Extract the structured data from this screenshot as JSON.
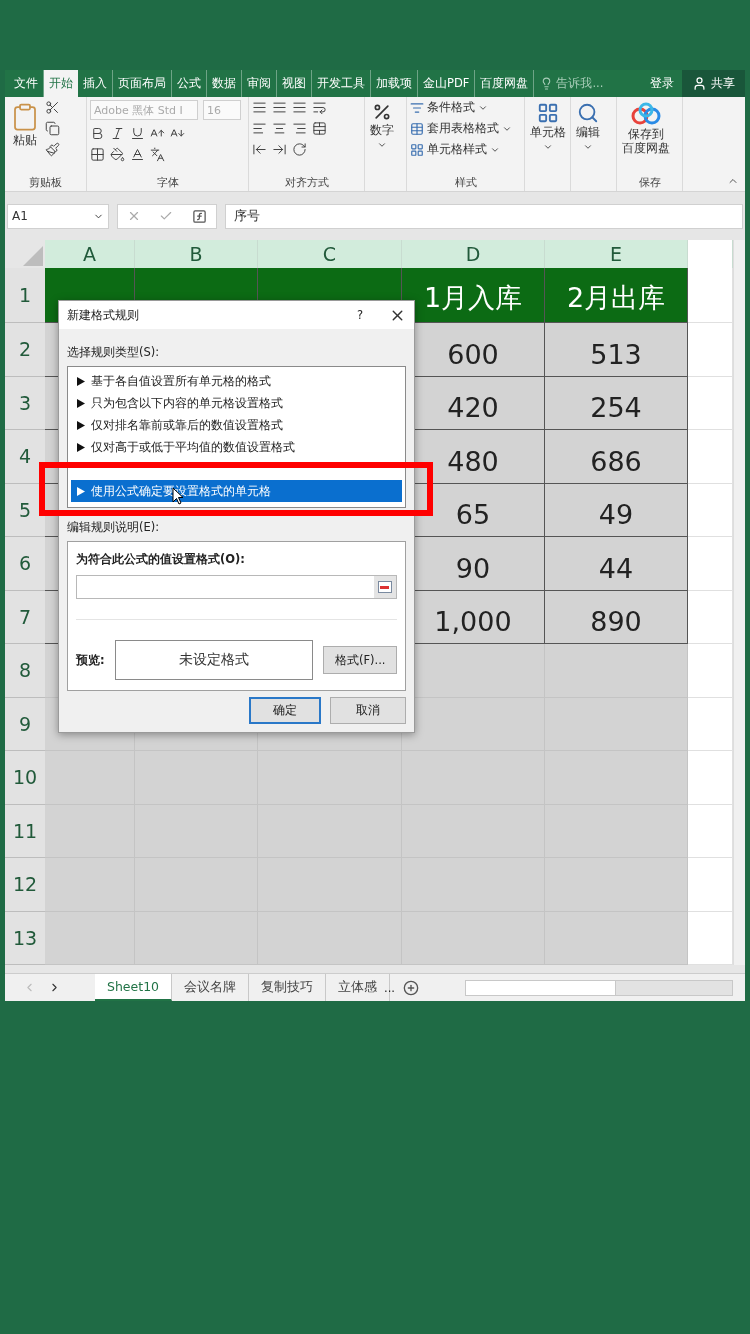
{
  "ribbon_tabs": [
    {
      "label": "文件",
      "selected": false
    },
    {
      "label": "开始",
      "selected": true
    },
    {
      "label": "插入",
      "selected": false
    },
    {
      "label": "页面布局",
      "selected": false
    },
    {
      "label": "公式",
      "selected": false
    },
    {
      "label": "数据",
      "selected": false
    },
    {
      "label": "审阅",
      "selected": false
    },
    {
      "label": "视图",
      "selected": false
    },
    {
      "label": "开发工具",
      "selected": false
    },
    {
      "label": "加载项",
      "selected": false
    },
    {
      "label": "金山PDF",
      "selected": false
    },
    {
      "label": "百度网盘",
      "selected": false
    }
  ],
  "tell_me": "告诉我...",
  "sign_in": "登录",
  "share": "共享",
  "ribbon": {
    "clipboard": {
      "paste": "粘贴",
      "label": "剪贴板"
    },
    "font": {
      "name": "Adobe 黑体 Std I",
      "size": "16",
      "label": "字体"
    },
    "alignment": {
      "label": "对齐方式"
    },
    "number": {
      "button": "数字"
    },
    "styles": {
      "items": [
        "条件格式",
        "套用表格格式",
        "单元格样式"
      ],
      "label": "样式"
    },
    "cells": {
      "button": "单元格"
    },
    "editing": {
      "button": "编辑"
    },
    "save": {
      "button": [
        "保存到",
        "百度网盘"
      ],
      "label": "保存"
    }
  },
  "formula_bar": {
    "name_box": "A1",
    "content": "序号"
  },
  "sheet": {
    "columns": [
      "A",
      "B",
      "C",
      "D",
      "E"
    ],
    "rows": [
      {
        "number": "1",
        "kind": "header",
        "cells": {
          "D": "1月入库",
          "E": "2月出库"
        }
      },
      {
        "number": "2",
        "kind": "data",
        "cells": {
          "D": "600",
          "E": "513"
        }
      },
      {
        "number": "3",
        "kind": "data",
        "cells": {
          "D": "420",
          "E": "254"
        }
      },
      {
        "number": "4",
        "kind": "data",
        "cells": {
          "D": "480",
          "E": "686"
        }
      },
      {
        "number": "5",
        "kind": "data",
        "cells": {
          "D": "65",
          "E": "49"
        }
      },
      {
        "number": "6",
        "kind": "data",
        "cells": {
          "D": "90",
          "E": "44"
        }
      },
      {
        "number": "7",
        "kind": "data",
        "cells": {
          "D": "1,000",
          "E": "890"
        }
      },
      {
        "number": "8",
        "kind": "blank"
      },
      {
        "number": "9",
        "kind": "blank"
      },
      {
        "number": "10",
        "kind": "blank"
      },
      {
        "number": "11",
        "kind": "blank"
      },
      {
        "number": "12",
        "kind": "blank"
      },
      {
        "number": "13",
        "kind": "blank"
      }
    ]
  },
  "sheet_tabs": [
    {
      "label": "Sheet10",
      "selected": true
    },
    {
      "label": "会议名牌",
      "selected": false
    },
    {
      "label": "复制技巧",
      "selected": false
    },
    {
      "label": "立体感",
      "selected": false
    }
  ],
  "more_tabs": "...",
  "dialog": {
    "title": "新建格式规则",
    "help": "?",
    "select_label": "选择规则类型(S):",
    "rule_types": [
      {
        "label": "基于各自值设置所有单元格的格式",
        "selected": false
      },
      {
        "label": "只为包含以下内容的单元格设置格式",
        "selected": false
      },
      {
        "label": "仅对排名靠前或靠后的数值设置格式",
        "selected": false
      },
      {
        "label": "仅对高于或低于平均值的数值设置格式",
        "selected": false
      },
      {
        "label": "使用公式确定要设置格式的单元格",
        "selected": true
      }
    ],
    "edit_label": "编辑规则说明(E):",
    "formula_label": "为符合此公式的值设置格式(O):",
    "preview_label": "预览:",
    "preview_text": "未设定格式",
    "format_button": "格式(F)...",
    "ok": "确定",
    "cancel": "取消"
  }
}
